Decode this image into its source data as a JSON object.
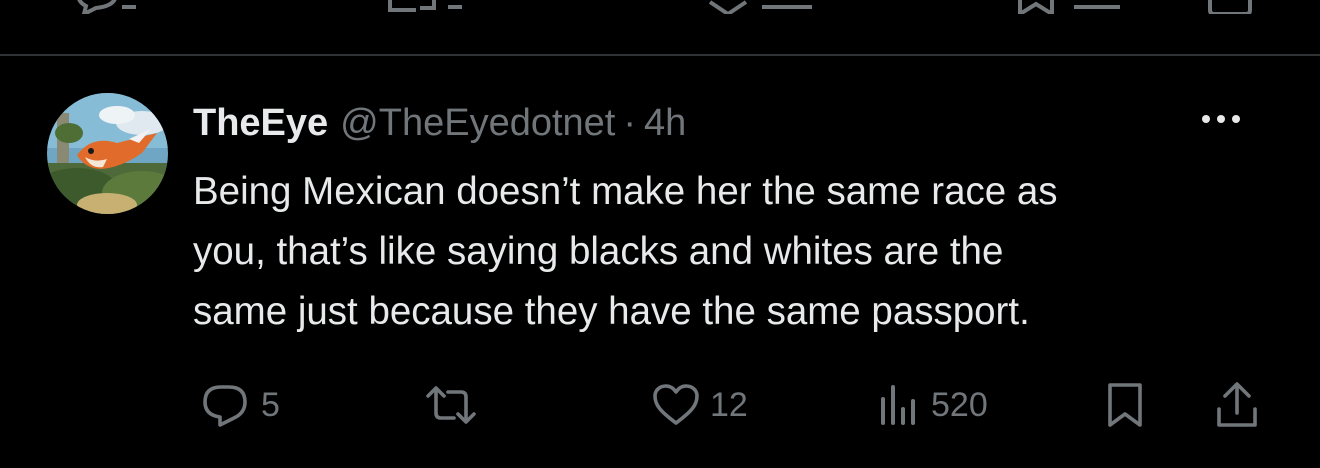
{
  "tweet": {
    "display_name": "TheEye",
    "handle": "@TheEyedotnet",
    "separator": "·",
    "time": "4h",
    "text_lines": [
      "Being Mexican doesn’t make her the same race as",
      "you, that’s like saying blacks and whites are the",
      "same just because they have the same passport."
    ]
  },
  "actions": {
    "replies": "5",
    "reposts": "",
    "likes": "12",
    "views": "520"
  },
  "icons": {
    "reply": "reply-icon",
    "repost": "repost-icon",
    "like": "heart-icon",
    "views": "views-icon",
    "bookmark": "bookmark-icon",
    "share": "share-icon",
    "more": "more-icon"
  },
  "colors": {
    "background": "#000000",
    "text": "#e7e9ea",
    "muted": "#71767b",
    "divider": "#2f3336"
  }
}
